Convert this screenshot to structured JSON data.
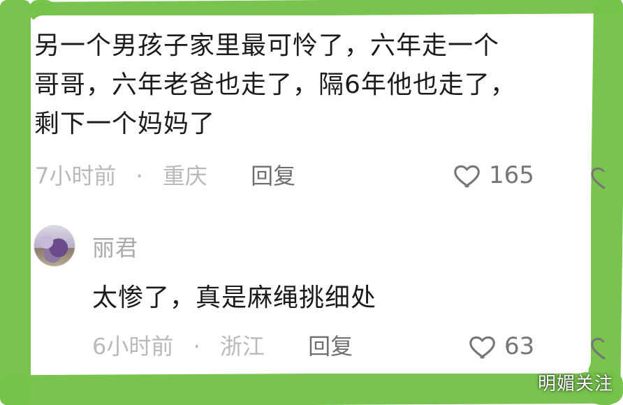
{
  "comment": {
    "text": "另一个男孩子家里最可怜了，六年走一个\n哥哥，六年老爸也走了，隔6年他也走了，\n剩下一个妈妈了",
    "meta": {
      "time": "7小时前",
      "separator": "·",
      "location": "重庆",
      "reply_label": "回复"
    },
    "likes": {
      "count": "165",
      "icon": "heart-icon"
    }
  },
  "reply": {
    "username": "丽君",
    "text": "太惨了，真是麻绳挑细处",
    "meta": {
      "time": "6小时前",
      "separator": "·",
      "location": "浙江",
      "reply_label": "回复"
    },
    "likes": {
      "count": "63",
      "icon": "heart-icon"
    }
  },
  "watermark": {
    "text": "明媚关注"
  },
  "colors": {
    "highlight_green": "#75c34a",
    "text_primary": "#1b1b1b",
    "text_muted": "#b9b9b9",
    "text_action": "#6f6f6f",
    "icon_gray": "#767676"
  }
}
